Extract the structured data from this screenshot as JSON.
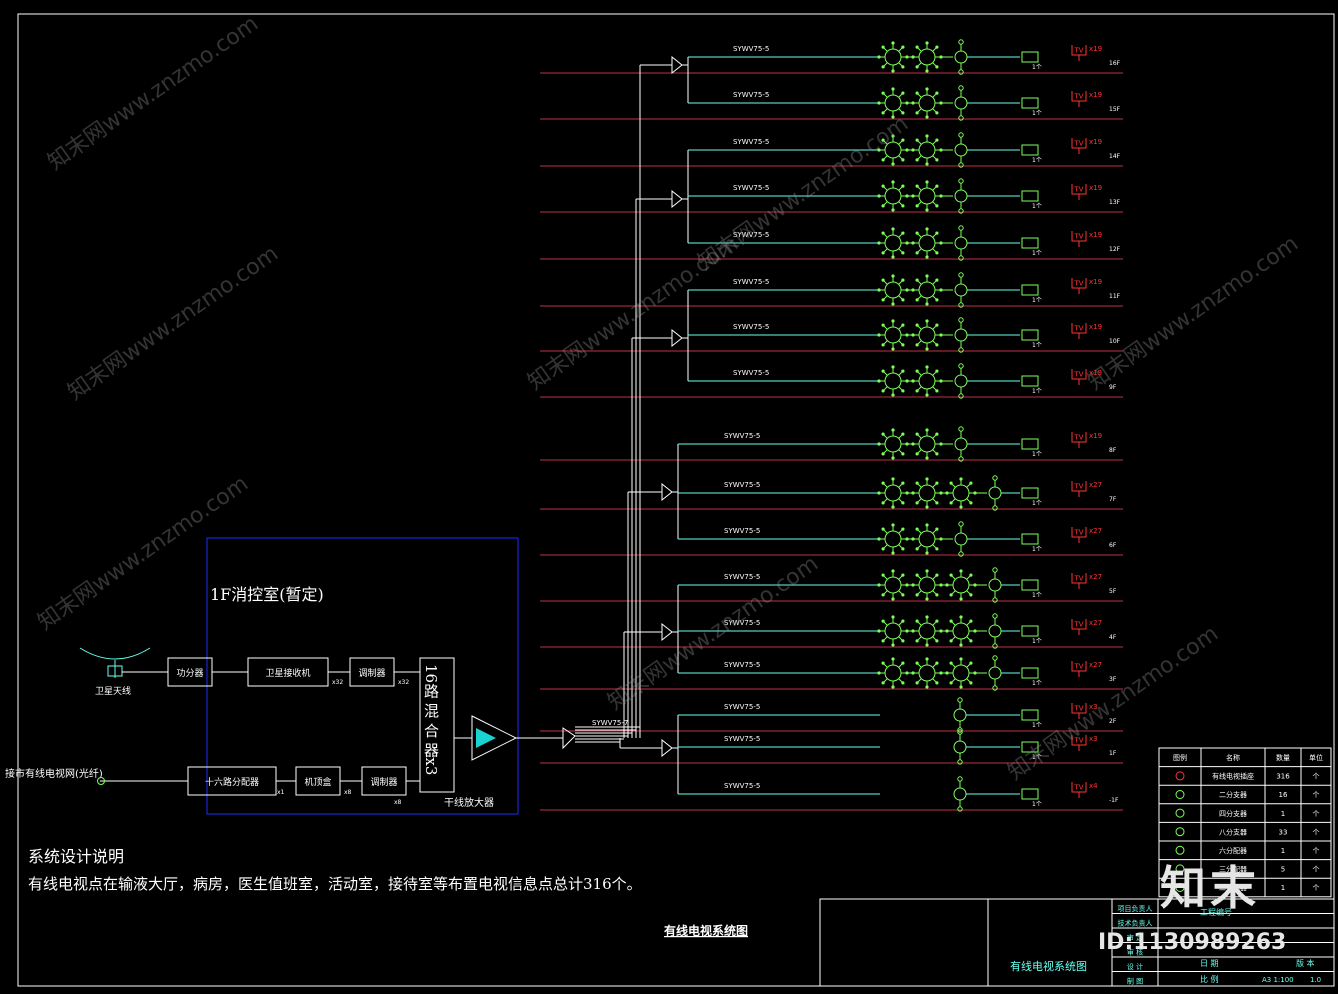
{
  "colors": {
    "background": "#000000",
    "trunk": "#ffffff",
    "floor_line": "#c0304a",
    "cable": "#66ffee",
    "splitter": "#7cff5a",
    "outlet": "#ff3333",
    "control_room": "#1f2cff",
    "amplifier": "#19d3d3"
  },
  "watermark": {
    "text": "知末网www.znzmo.com"
  },
  "control_room": {
    "title": "1F消控室(暂定)",
    "satellite_label": "卫星天线",
    "city_network_label": "接市有线电视网(光纤)",
    "power_divider": "功分器",
    "sat_receiver": "卫星接收机",
    "modulator_top": "调制器",
    "x32a": "x32",
    "x32b": "x32",
    "splitter16": "十六路分配器",
    "x1": "x1",
    "stb": "机顶盒",
    "x8a": "x8",
    "modulator_bottom": "调制器",
    "x8b": "x8",
    "mixer": "16路 混 合 器x3",
    "amp_label": "干线放大器",
    "trunk_cable": "SYWV75-7"
  },
  "branches": [
    {
      "cable": "SYWV75-5",
      "splitters": 3,
      "count": "x19",
      "floor": "16F"
    },
    {
      "cable": "SYWV75-5",
      "splitters": 3,
      "count": "x19",
      "floor": "15F"
    },
    {
      "cable": "SYWV75-5",
      "splitters": 3,
      "count": "x19",
      "floor": "14F"
    },
    {
      "cable": "SYWV75-5",
      "splitters": 3,
      "count": "x19",
      "floor": "13F"
    },
    {
      "cable": "SYWV75-5",
      "splitters": 3,
      "count": "x19",
      "floor": "12F"
    },
    {
      "cable": "SYWV75-5",
      "splitters": 3,
      "count": "x19",
      "floor": "11F"
    },
    {
      "cable": "SYWV75-5",
      "splitters": 3,
      "count": "x19",
      "floor": "10F"
    },
    {
      "cable": "SYWV75-5",
      "splitters": 3,
      "count": "x19",
      "floor": "9F"
    },
    {
      "cable": "SYWV75-5",
      "splitters": 3,
      "count": "x19",
      "floor": "8F"
    },
    {
      "cable": "SYWV75-5",
      "splitters": 4,
      "count": "x27",
      "floor": "7F"
    },
    {
      "cable": "SYWV75-5",
      "splitters": 3,
      "count": "x27",
      "floor": "6F"
    },
    {
      "cable": "SYWV75-5",
      "splitters": 4,
      "count": "x27",
      "floor": "5F"
    },
    {
      "cable": "SYWV75-5",
      "splitters": 4,
      "count": "x27",
      "floor": "4F"
    },
    {
      "cable": "SYWV75-5",
      "splitters": 4,
      "count": "x27",
      "floor": "3F"
    },
    {
      "cable": "SYWV75-5",
      "splitters": 1,
      "count": "x3",
      "floor": "2F"
    },
    {
      "cable": "SYWV75-5",
      "splitters": 1,
      "count": "x3",
      "floor": "1F"
    },
    {
      "cable": "SYWV75-5",
      "splitters": 1,
      "count": "x4",
      "floor": "-1F"
    }
  ],
  "outlet_tag": "TV",
  "unit_tag": "1个",
  "legend": {
    "headers": [
      "图例",
      "名称",
      "数量",
      "单位"
    ],
    "rows": [
      {
        "name": "有线电视插座",
        "qty": "316",
        "unit": "个"
      },
      {
        "name": "二分支器",
        "qty": "16",
        "unit": "个"
      },
      {
        "name": "四分支器",
        "qty": "1",
        "unit": "个"
      },
      {
        "name": "八分支器",
        "qty": "33",
        "unit": "个"
      },
      {
        "name": "六分配器",
        "qty": "1",
        "unit": "个"
      },
      {
        "name": "三分配器",
        "qty": "5",
        "unit": "个"
      },
      {
        "name": "二分配器",
        "qty": "1",
        "unit": "个"
      }
    ]
  },
  "notes": {
    "heading": "系统设计说明",
    "body": "有线电视点在输液大厅，病房，医生值班室，活动室，接待室等布置电视信息点总计316个。"
  },
  "drawing_title": "有线电视系统图",
  "title_block": {
    "name": "有线电视系统图",
    "labels": [
      "项目负责人",
      "技术负责人",
      "审 定",
      "审 核",
      "设 计",
      "制 图"
    ],
    "project_no": "工程编号",
    "date": "日 期",
    "scale_label": "比 例",
    "scale": "A3 1:100",
    "version_label": "版 本",
    "version": "1.0"
  },
  "logo": "知末",
  "id_text": "ID:1130989263"
}
